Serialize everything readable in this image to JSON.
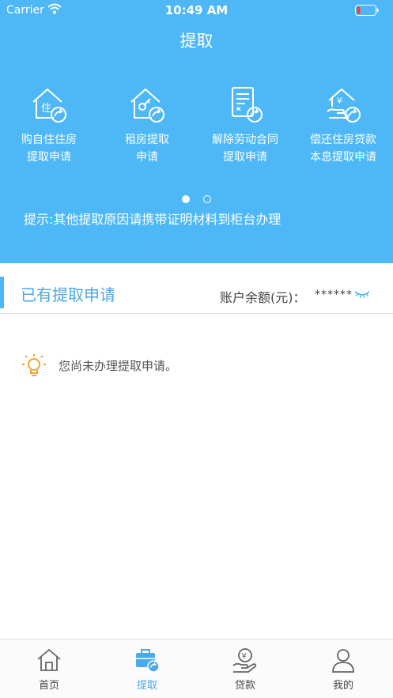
{
  "status_bar": {
    "carrier": "Carrier",
    "time": "10:49 AM"
  },
  "header": {
    "title": "提取",
    "background_color": "#4db8f5",
    "shortcuts": [
      {
        "line1": "购自住住房",
        "line2": "提取申请",
        "icon": "house-withdraw-icon"
      },
      {
        "line1": "租房提取",
        "line2": "申请",
        "icon": "rent-house-icon"
      },
      {
        "line1": "解除劳动合同",
        "line2": "提取申请",
        "icon": "contract-document-icon"
      },
      {
        "line1": "偿还住房贷款",
        "line2": "本息提取申请",
        "icon": "loan-repay-icon"
      }
    ],
    "pager": {
      "total": 2,
      "current": 1
    },
    "tip": "提示:其他提取原因请携带证明材料到柜台办理"
  },
  "applications": {
    "title": "已有提取申请",
    "balance_label": "账户余额(元)：",
    "balance_value": "******",
    "empty_message": "您尚未办理提取申请。",
    "accent_color": "#4aa9e8"
  },
  "tabbar": {
    "tabs": [
      {
        "label": "首页",
        "icon": "home-icon",
        "active": false
      },
      {
        "label": "提取",
        "icon": "withdraw-briefcase-icon",
        "active": true
      },
      {
        "label": "贷款",
        "icon": "loan-hand-icon",
        "active": false
      },
      {
        "label": "我的",
        "icon": "profile-icon",
        "active": false
      }
    ]
  }
}
